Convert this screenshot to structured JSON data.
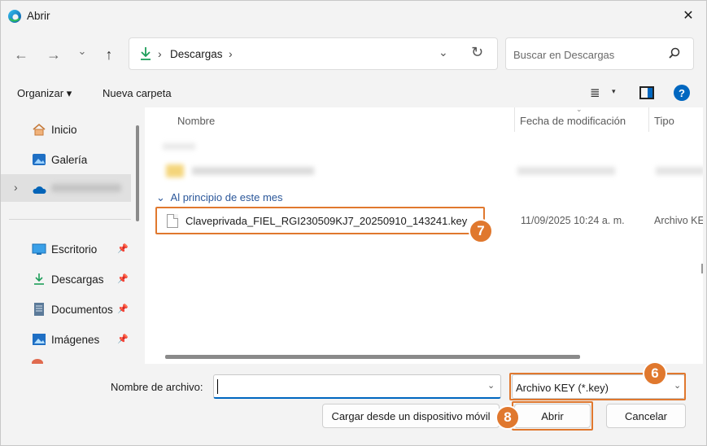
{
  "window": {
    "title": "Abrir",
    "close_glyph": "✕"
  },
  "nav": {
    "back_glyph": "←",
    "forward_glyph": "→",
    "recent_glyph": "⌄",
    "up_glyph": "↑"
  },
  "address": {
    "current_folder": "Descargas",
    "separator": "›",
    "dropdown_glyph": "⌄",
    "refresh_glyph": "↻"
  },
  "search": {
    "placeholder": "Buscar en Descargas"
  },
  "commandbar": {
    "organize_label": "Organizar ▾",
    "new_folder_label": "Nueva carpeta",
    "view_glyph": "≣",
    "view_caret": "▾",
    "help_glyph": "?"
  },
  "sidebar": {
    "items": [
      {
        "label": "Inicio",
        "icon": "home-icon"
      },
      {
        "label": "Galería",
        "icon": "gallery-icon"
      },
      {
        "label": "",
        "icon": "onedrive-icon",
        "expander": "›"
      },
      {
        "label": "Escritorio",
        "icon": "desktop-icon",
        "pin": "📌"
      },
      {
        "label": "Descargas",
        "icon": "download-icon",
        "pin": "📌"
      },
      {
        "label": "Documentos",
        "icon": "documents-icon",
        "pin": "📌"
      },
      {
        "label": "Imágenes",
        "icon": "pictures-icon",
        "pin": "📌"
      }
    ]
  },
  "files": {
    "columns": [
      "Nombre",
      "Fecha de modificación",
      "Tipo"
    ],
    "sort_indicator": "⌄",
    "group_label": "Al principio de este mes",
    "group_chevron": "⌄",
    "rows": [
      {
        "name": "Claveprivada_FIEL_RGI230509KJ7_20250910_143241.key",
        "date": "11/09/2025 10:24 a. m.",
        "type": "Archivo KEY"
      }
    ]
  },
  "footer": {
    "filename_label": "Nombre de archivo:",
    "filename_value": "",
    "filter_value": "Archivo KEY (*.key)",
    "dropdown_glyph": "⌄",
    "mobile_button": "Cargar desde un dispositivo móvil",
    "open_button": "Abrir",
    "cancel_button": "Cancelar"
  },
  "annotations": {
    "step_file": "7",
    "step_filter": "6",
    "step_open": "8",
    "highlight_color": "#e0782e"
  },
  "colors": {
    "accent": "#0067c0",
    "onedrive": "#0364b8"
  }
}
